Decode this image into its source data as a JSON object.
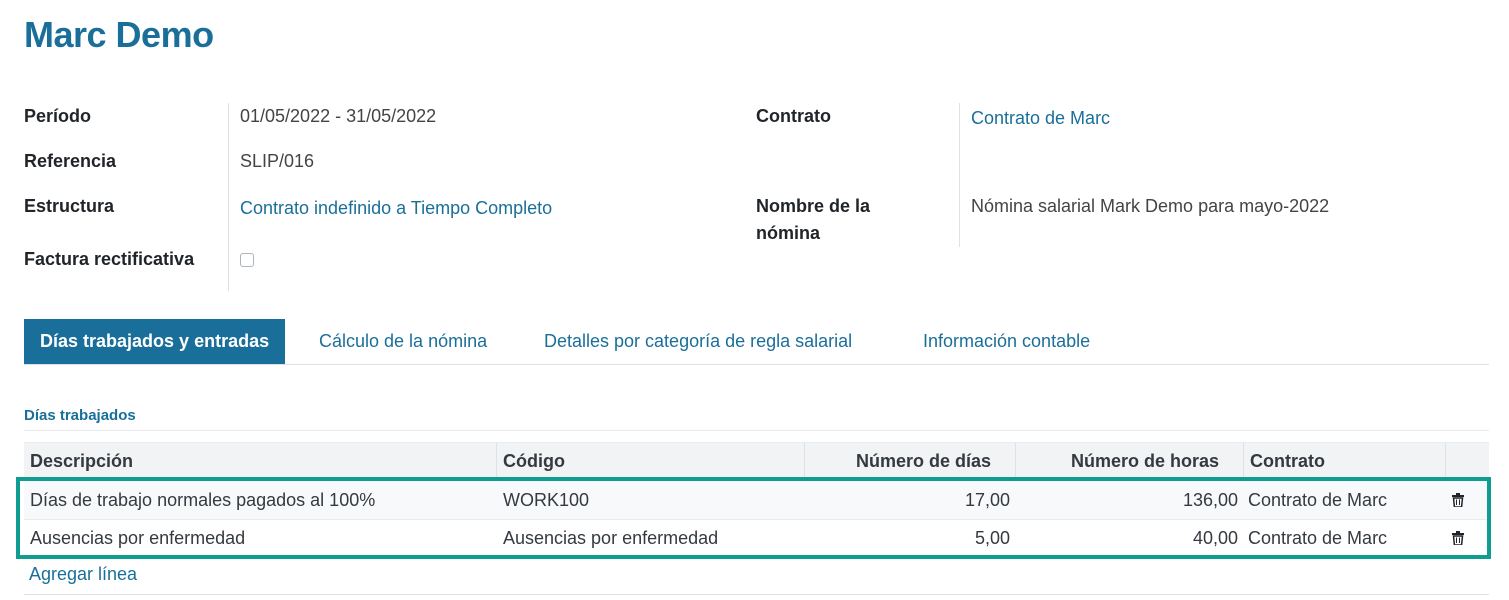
{
  "page": {
    "title": "Marc Demo"
  },
  "fields": {
    "periodo": {
      "label": "Período",
      "value": "01/05/2022 - 31/05/2022"
    },
    "referencia": {
      "label": "Referencia",
      "value": "SLIP/016"
    },
    "estructura": {
      "label": "Estructura",
      "value": "Contrato indefinido a Tiempo Completo"
    },
    "factura": {
      "label": "Factura rectificativa",
      "checked": false
    },
    "contrato": {
      "label": "Contrato",
      "value": "Contrato de Marc"
    },
    "nombre": {
      "label_line1": "Nombre de la",
      "label_line2": "nómina",
      "value": "Nómina salarial Mark Demo para mayo-2022"
    }
  },
  "tabs": [
    {
      "label": "Días trabajados y entradas",
      "active": true
    },
    {
      "label": "Cálculo de la nómina",
      "active": false
    },
    {
      "label": "Detalles por categoría de regla salarial",
      "active": false
    },
    {
      "label": "Información contable",
      "active": false
    }
  ],
  "section": {
    "title": "Días trabajados"
  },
  "table": {
    "columns": [
      "Descripción",
      "Código",
      "Número de días",
      "Número de horas",
      "Contrato"
    ],
    "rows": [
      {
        "descripcion": "Días de trabajo normales pagados al 100%",
        "codigo": "WORK100",
        "dias": "17,00",
        "horas": "136,00",
        "contrato": "Contrato de Marc",
        "delete_icon": "trash-icon"
      },
      {
        "descripcion": "Ausencias por enfermedad",
        "codigo": "Ausencias por enfermedad",
        "dias": "5,00",
        "horas": "40,00",
        "contrato": "Contrato de Marc",
        "delete_icon": "trash-icon"
      }
    ],
    "add_line": "Agregar línea"
  },
  "colors": {
    "accent": "#1a6f9a",
    "highlight": "#0f9d91"
  }
}
